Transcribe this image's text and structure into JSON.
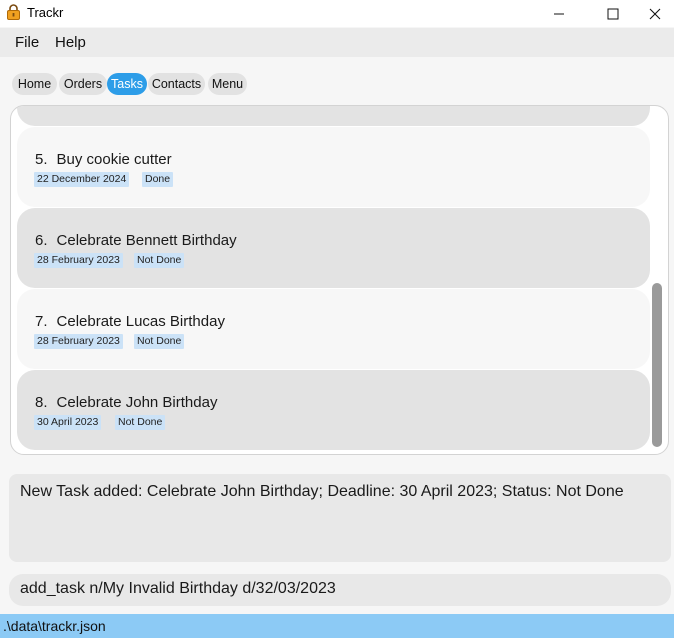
{
  "window": {
    "title": "Trackr",
    "icon": "lock-icon",
    "controls": [
      "minimize-icon",
      "maximize-icon",
      "close-icon"
    ]
  },
  "menu": {
    "file": "File",
    "help": "Help"
  },
  "tabs": [
    {
      "label": "Home",
      "active": false
    },
    {
      "label": "Orders",
      "active": false
    },
    {
      "label": "Tasks",
      "active": true
    },
    {
      "label": "Contacts",
      "active": false
    },
    {
      "label": "Menu",
      "active": false
    }
  ],
  "tasks": [
    {
      "index": "5.",
      "name": "Buy cookie cutter",
      "deadline": "22 December 2024",
      "status": "Done"
    },
    {
      "index": "6.",
      "name": "Celebrate Bennett Birthday",
      "deadline": "28 February 2023",
      "status": "Not Done"
    },
    {
      "index": "7.",
      "name": "Celebrate Lucas Birthday",
      "deadline": "28 February 2023",
      "status": "Not Done"
    },
    {
      "index": "8.",
      "name": "Celebrate John Birthday",
      "deadline": "30 April 2023",
      "status": "Not Done"
    }
  ],
  "result": {
    "text": "New Task added: Celebrate John Birthday; Deadline: 30 April 2023; Status: Not Done"
  },
  "command": {
    "value": "add_task n/My Invalid Birthday d/32/03/2023"
  },
  "status_bar": {
    "path": ".\\data\\trackr.json"
  },
  "colors": {
    "accent": "#2d9de8",
    "tag_bg": "#cbe2f7",
    "status_bar": "#8ccaf5"
  }
}
